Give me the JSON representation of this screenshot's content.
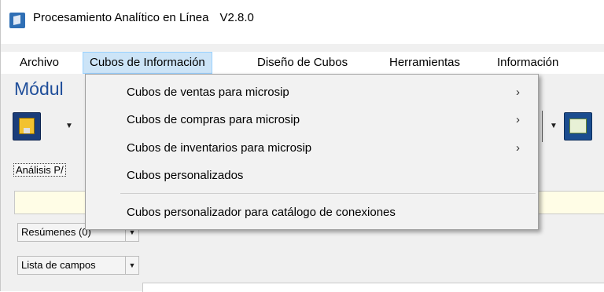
{
  "window": {
    "title": "Procesamiento Analítico en Línea",
    "version": "V2.8.0"
  },
  "menubar": {
    "items": [
      "Archivo",
      "Cubos de Información",
      "Diseño de Cubos",
      "Herramientas",
      "Información"
    ]
  },
  "module_title": "Módul",
  "tab": {
    "label": "Análisis P/"
  },
  "fields": {
    "resumenes": "Resúmenes (0)",
    "lista_campos": "Lista de campos"
  },
  "popup_menu": {
    "items": [
      {
        "label": "Cubos de ventas para microsip",
        "chevron": "›"
      },
      {
        "label": "Cubos de compras para microsip",
        "chevron": "›"
      },
      {
        "label": "Cubos de inventarios para microsip",
        "chevron": "›"
      },
      {
        "label": "Cubos personalizados",
        "chevron": ""
      },
      {
        "label": "Cubos personalizador para catálogo de conexiones",
        "chevron": ""
      }
    ]
  },
  "icons": {
    "app": "cube-app-icon",
    "save": "floppy-disk-icon",
    "calc": "spreadsheet-sum-icon",
    "dropdown": "triangle-down-icon"
  },
  "colors": {
    "menu_highlight": "#cce4f7",
    "module_title": "#1f4e9a",
    "popup_bg": "#f2f2f2",
    "yellow_bar": "#fffde6"
  }
}
